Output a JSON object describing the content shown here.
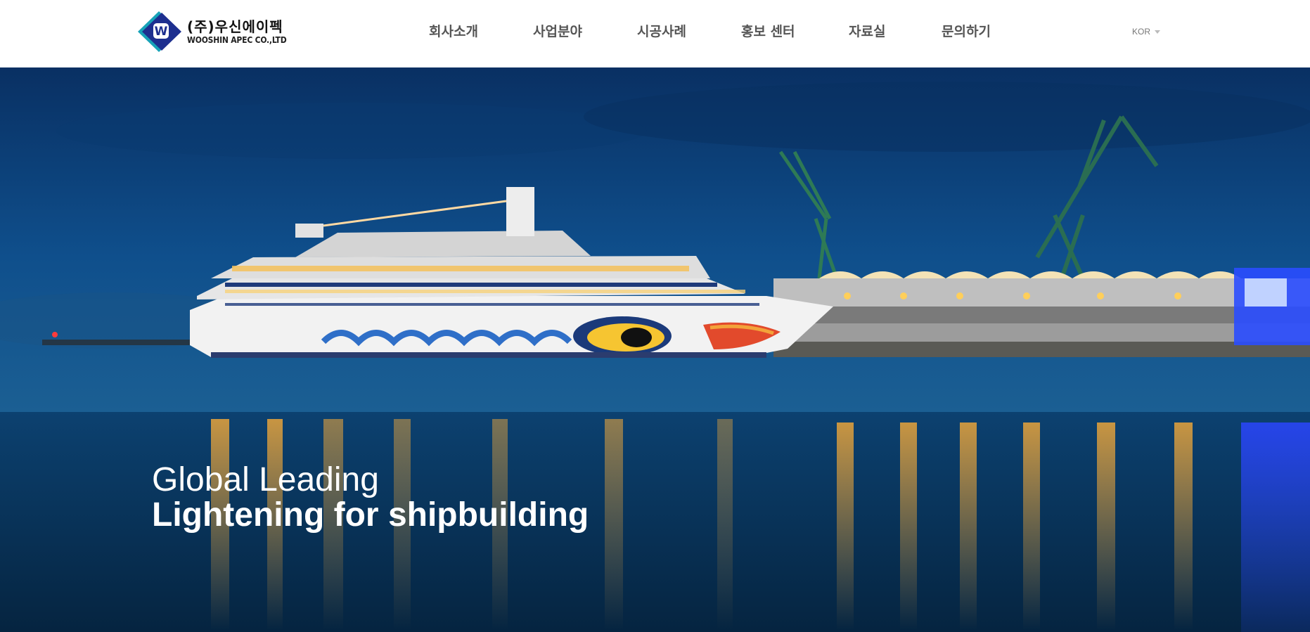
{
  "header": {
    "logo": {
      "korean_name": "(주)우신에이펙",
      "english_name": "WOOSHIN APEC CO.,LTD",
      "mark_letter": "W",
      "icon": "diamond-logo-icon"
    },
    "nav": [
      {
        "label": "회사소개"
      },
      {
        "label": "사업분야"
      },
      {
        "label": "시공사례"
      },
      {
        "label": "홍보 센터"
      },
      {
        "label": "자료실"
      },
      {
        "label": "문의하기"
      }
    ],
    "language": {
      "label": "KOR",
      "icon": "caret-down-icon"
    }
  },
  "hero": {
    "headline_line1": "Global Leading",
    "headline_line2_bold": "Lightening",
    "headline_line2_rest": " for shipbuilding"
  },
  "colors": {
    "logo_navy": "#1d2f8f",
    "logo_teal": "#17a3b8",
    "nav_text": "#555555",
    "hero_sky": "#0d4a86",
    "hero_water": "#072a4a"
  }
}
